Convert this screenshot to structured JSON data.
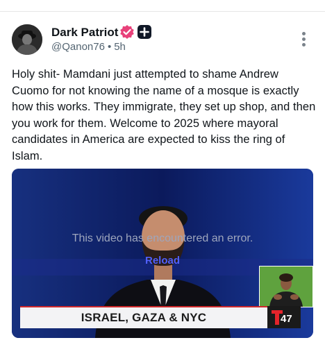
{
  "post": {
    "display_name": "Dark Patriot",
    "handle": "@Qanon76",
    "time": "5h",
    "text": "Holy shit- Mamdani just attempted to shame Andrew Cuomo for not knowing the name of a mosque is exactly how this works. They immigrate, they set up shop, and then you work for them. Welcome to 2025 where mayoral candidates in America are expected to kiss the ring of Islam."
  },
  "video": {
    "error_message": "This video has encountered an error.",
    "reload_label": "Reload",
    "banner_text": "ISRAEL, GAZA & NYC",
    "channel_logo_number": "47"
  },
  "colors": {
    "verified_badge": "#e8417a",
    "video_background": "#0c1f6b",
    "reload_link": "#5060ff",
    "banner_accent": "#d0282b"
  },
  "icons": [
    "avatar-image",
    "verified-badge-icon",
    "plus-badge-icon",
    "more-options-icon",
    "telemundo-logo-icon"
  ]
}
